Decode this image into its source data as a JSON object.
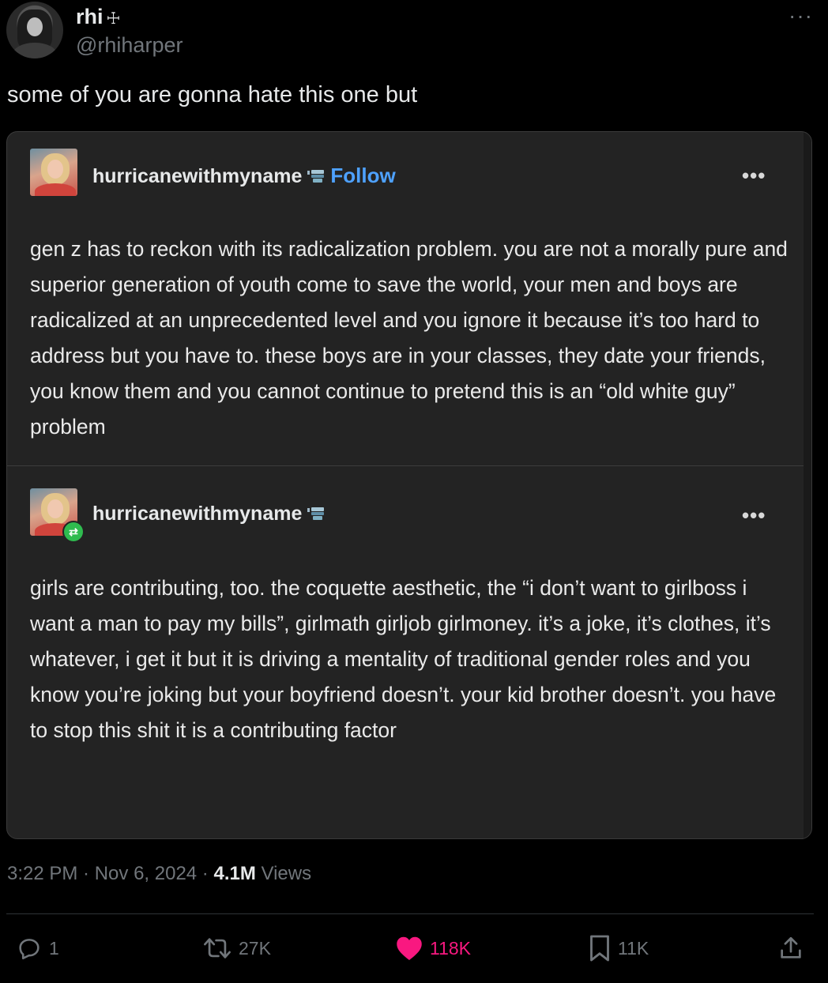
{
  "author": {
    "display_name": "rhi",
    "name_glyph": "☩",
    "handle": "@rhiharper"
  },
  "tweet_text": "some of you are gonna hate this one but",
  "embedded": {
    "post1": {
      "username": "hurricanewithmyname",
      "follow_label": "Follow",
      "more_label": "•••",
      "body": "gen z has to reckon with its radicalization problem. you are not a morally pure and superior generation of youth come to save the world, your men and boys are radicalized at an unprecedented level and you ignore it because it’s too hard to address but you have to. these boys are in your classes, they date your friends, you know them and you cannot continue to pretend this is an “old white guy” problem"
    },
    "post2": {
      "username": "hurricanewithmyname",
      "reblog_icon": "reblog-icon",
      "more_label": "•••",
      "body": "girls are contributing, too. the coquette aesthetic, the “i don’t want to girlboss i want a man to pay my bills”, girlmath girljob girlmoney. it’s a joke, it’s clothes, it’s whatever, i get it but it is driving a mentality of traditional gender roles and you know you’re joking but your boyfriend doesn’t. your kid brother doesn’t. you have to stop this shit it is a contributing factor"
    }
  },
  "meta": {
    "time": "3:22 PM",
    "sep1": " · ",
    "date": "Nov 6, 2024",
    "sep2": " · ",
    "views_count": "4.1M",
    "views_label": " Views"
  },
  "actions": {
    "replies": "1",
    "reposts": "27K",
    "likes": "118K",
    "bookmarks": "11K"
  },
  "more_label": "···",
  "colors": {
    "background": "#000000",
    "text": "#e7e9ea",
    "muted": "#71767b",
    "like": "#f91880",
    "follow": "#4ea1ff",
    "card": "#232323"
  }
}
